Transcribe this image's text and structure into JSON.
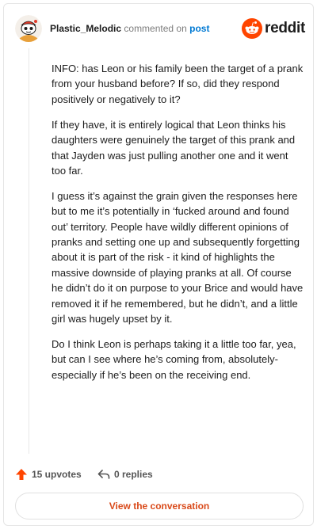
{
  "comment": {
    "username": "Plastic_Melodic",
    "action_text": "commented on",
    "post_link": "post",
    "paragraphs": [
      "INFO: has Leon or his family been the target of a prank from your husband before? If so, did they respond positively or negatively to it?",
      "If they have, it is entirely logical that Leon thinks his daughters were genuinely the target of this prank and that Jayden was just pulling another one and it went too far.",
      "I guess it’s against the grain given the responses here but to me it’s potentially in ‘fucked around and found out’ territory. People have wildly different opinions of pranks and setting one up and subsequently forgetting about it is part of the risk - it kind of highlights the massive downside of playing pranks at all. Of course he didn’t do it on purpose to your Brice and would have removed it if he remembered, but he didn’t, and a little girl was hugely upset by it.",
      "Do I think Leon is perhaps taking it a little too far, yea, but can I see where he’s coming from, absolutely- especially if he’s been on the receiving end."
    ]
  },
  "brand": {
    "wordmark": "reddit",
    "accent": "#ff4500"
  },
  "footer": {
    "upvotes": "15 upvotes",
    "replies": "0 replies"
  },
  "cta": {
    "label": "View the conversation"
  },
  "icons": {
    "avatar": "snoo-avatar-icon",
    "logo": "reddit-logo-icon",
    "upvote": "upvote-arrow-icon",
    "reply": "reply-arrow-icon"
  }
}
